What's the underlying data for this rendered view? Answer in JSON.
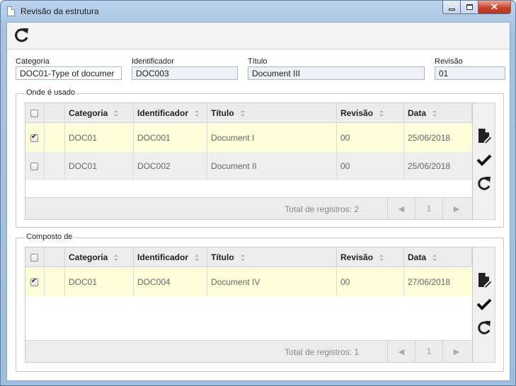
{
  "window": {
    "title": "Revisão da estrutura"
  },
  "fields": {
    "categoria": {
      "label": "Categoria",
      "value": "DOC01-Type of documer"
    },
    "identificador": {
      "label": "Identificador",
      "value": "DOC003"
    },
    "titulo": {
      "label": "Título",
      "value": "Document III"
    },
    "revisao": {
      "label": "Revisão",
      "value": "01"
    }
  },
  "columns": [
    "Categoria",
    "Identificador",
    "Título",
    "Revisão",
    "Data"
  ],
  "used_in": {
    "legend": "Onde é usado",
    "rows": [
      {
        "checked": true,
        "categoria": "DOC01",
        "identificador": "DOC001",
        "titulo": "Document I",
        "revisao": "00",
        "data": "25/06/2018"
      },
      {
        "checked": false,
        "categoria": "DOC01",
        "identificador": "DOC002",
        "titulo": "Document II",
        "revisao": "00",
        "data": "25/06/2018"
      }
    ],
    "total": "Total de registros: 2",
    "page": "1"
  },
  "composed_of": {
    "legend": "Composto de",
    "rows": [
      {
        "checked": true,
        "categoria": "DOC01",
        "identificador": "DOC004",
        "titulo": "Document IV",
        "revisao": "00",
        "data": "27/06/2018"
      }
    ],
    "total": "Total de registros: 1",
    "page": "1"
  },
  "icons": {
    "refresh": "refresh-icon",
    "edit": "edit-document-icon",
    "check": "check-icon",
    "undo": "refresh-icon"
  },
  "colors": {
    "selected_row": "#fdfdd9",
    "close_button": "#c9432c"
  }
}
